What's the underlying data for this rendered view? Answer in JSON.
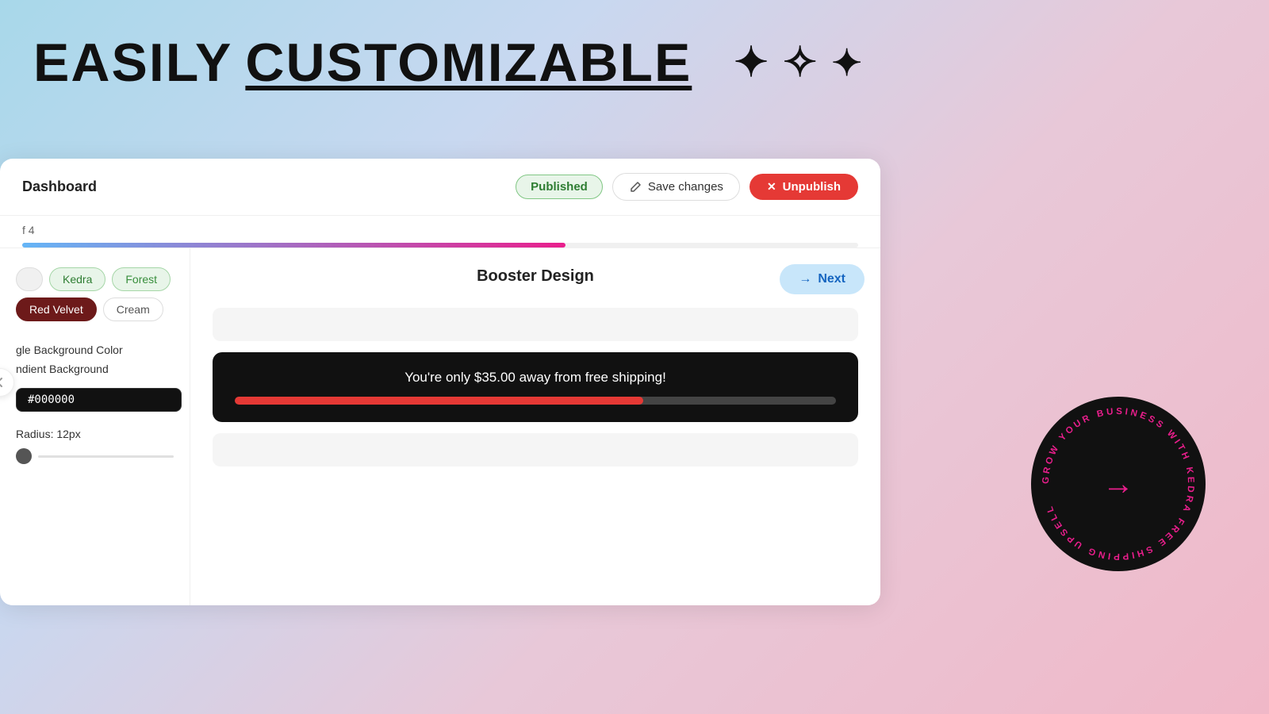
{
  "header": {
    "title_plain": "EASILY ",
    "title_underline": "CUSTOMIZABLE",
    "stars": [
      "✦",
      "✧",
      "✦"
    ]
  },
  "topbar": {
    "dashboard_label": "Dashboard",
    "published_label": "Published",
    "save_changes_label": "Save changes",
    "unpublish_label": "Unpublish"
  },
  "progress": {
    "step_label": "f 4",
    "fill_percent": "65%"
  },
  "sidebar": {
    "themes": [
      {
        "id": "basic",
        "label": ""
      },
      {
        "id": "kedra",
        "label": "Kedra"
      },
      {
        "id": "forest",
        "label": "Forest"
      },
      {
        "id": "redvelvet",
        "label": "Red Velvet"
      },
      {
        "id": "cream",
        "label": "Cream"
      }
    ],
    "bg_color_label": "gle Background Color",
    "gradient_label": "ndient Background",
    "color_value": "#000000",
    "radius_label": "Radius: 12px"
  },
  "main": {
    "section_title": "Booster Design",
    "next_label": "Next",
    "shipping_text": "You're only $35.00 away from free shipping!",
    "shipping_progress": 68
  },
  "circular_badge": {
    "text": "GROW YOUR BUSINESS WITH KEDRA FREE SHIPPING UPSELL"
  }
}
